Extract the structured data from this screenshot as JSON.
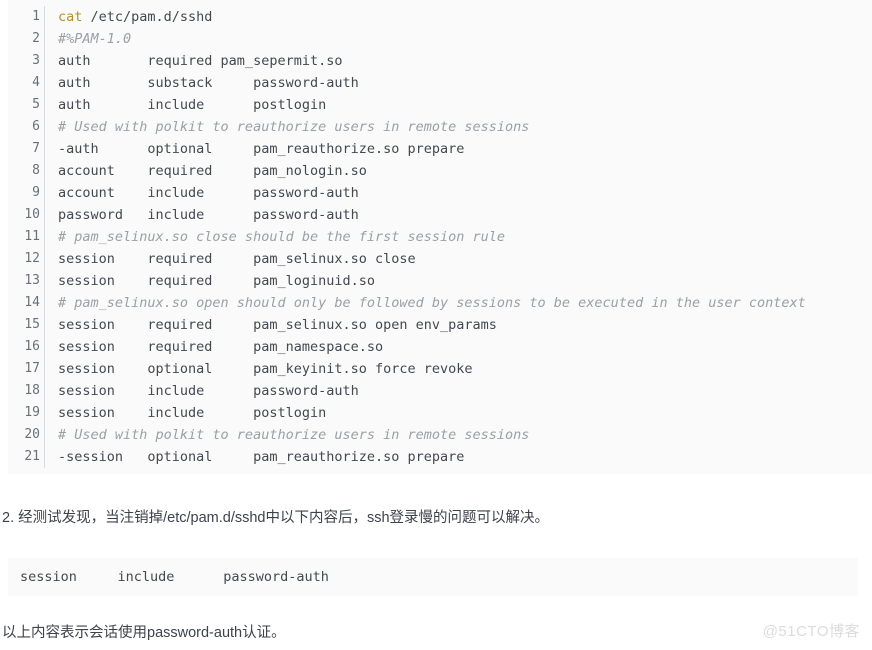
{
  "code_block": {
    "language": "shell",
    "background": "#fafafa",
    "gutter_color": "#6b7078",
    "comment_color": "#9aa0a6",
    "command_color": "#b58b2e",
    "lines": [
      {
        "n": "1",
        "type": "command",
        "cmd": "cat",
        "arg": " /etc/pam.d/sshd"
      },
      {
        "n": "2",
        "type": "comment",
        "text": "#%PAM-1.0"
      },
      {
        "n": "3",
        "type": "code",
        "text": "auth       required pam_sepermit.so"
      },
      {
        "n": "4",
        "type": "code",
        "text": "auth       substack     password-auth"
      },
      {
        "n": "5",
        "type": "code",
        "text": "auth       include      postlogin"
      },
      {
        "n": "6",
        "type": "comment",
        "text": "# Used with polkit to reauthorize users in remote sessions"
      },
      {
        "n": "7",
        "type": "code",
        "text": "-auth      optional     pam_reauthorize.so prepare"
      },
      {
        "n": "8",
        "type": "code",
        "text": "account    required     pam_nologin.so"
      },
      {
        "n": "9",
        "type": "code",
        "text": "account    include      password-auth"
      },
      {
        "n": "10",
        "type": "code",
        "text": "password   include      password-auth"
      },
      {
        "n": "11",
        "type": "comment",
        "text": "# pam_selinux.so close should be the first session rule"
      },
      {
        "n": "12",
        "type": "code",
        "text": "session    required     pam_selinux.so close"
      },
      {
        "n": "13",
        "type": "code",
        "text": "session    required     pam_loginuid.so"
      },
      {
        "n": "14",
        "type": "comment",
        "text": "# pam_selinux.so open should only be followed by sessions to be executed in the user context"
      },
      {
        "n": "15",
        "type": "code",
        "text": "session    required     pam_selinux.so open env_params"
      },
      {
        "n": "16",
        "type": "code",
        "text": "session    required     pam_namespace.so"
      },
      {
        "n": "17",
        "type": "code",
        "text": "session    optional     pam_keyinit.so force revoke"
      },
      {
        "n": "18",
        "type": "code",
        "text": "session    include      password-auth"
      },
      {
        "n": "19",
        "type": "code",
        "text": "session    include      postlogin"
      },
      {
        "n": "20",
        "type": "comment",
        "text": "# Used with polkit to reauthorize users in remote sessions"
      },
      {
        "n": "21",
        "type": "code",
        "text": "-session   optional     pam_reauthorize.so prepare"
      }
    ]
  },
  "body": {
    "paragraph_1": "2. 经测试发现，当注销掉/etc/pam.d/sshd中以下内容后，ssh登录慢的问题可以解决。",
    "paragraph_2": "以上内容表示会话使用password-auth认证。"
  },
  "snippet": {
    "text": "session     include      password-auth",
    "background": "#fafafa"
  },
  "watermark": {
    "text": "@51CTO博客",
    "color": "#dcdcdc"
  }
}
